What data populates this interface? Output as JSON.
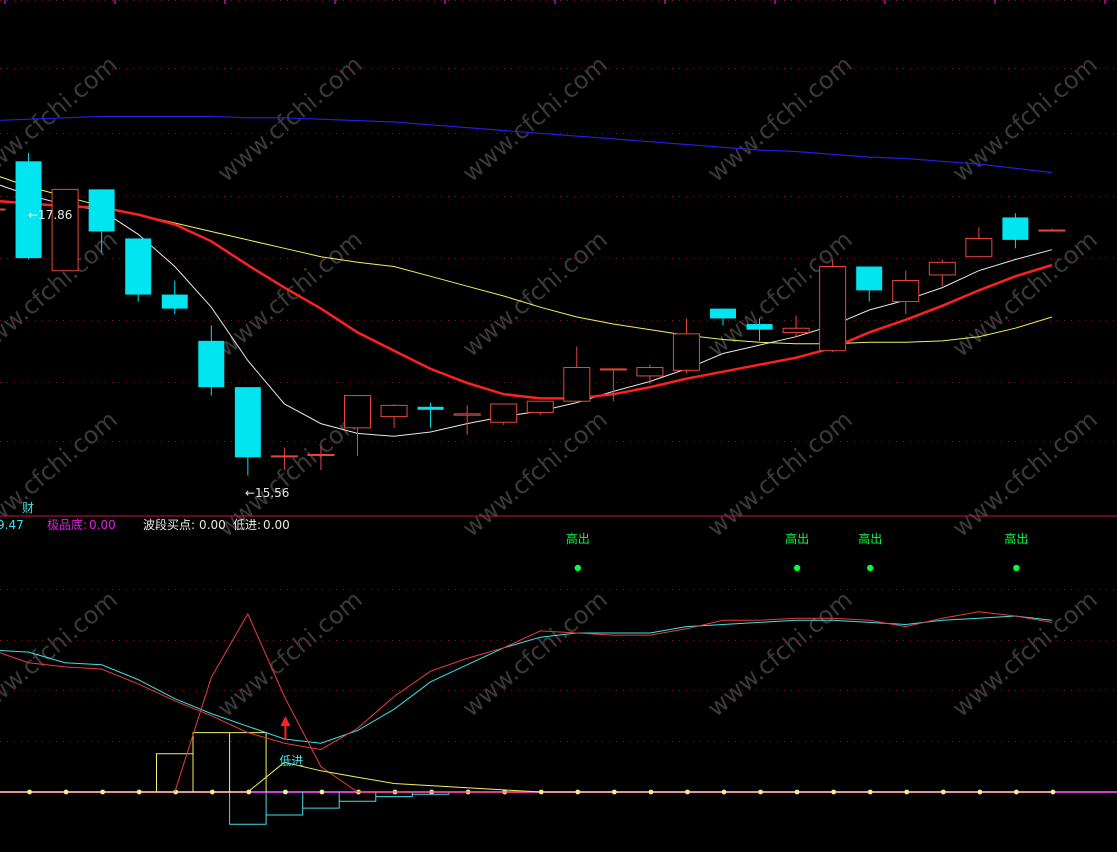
{
  "colors": {
    "background": "#000000",
    "grid": "#8a0e2c",
    "divider": "#d0103a",
    "up_candle": "#e8463c",
    "down_candle": "#00e5f0",
    "ma_fast": "#e8e8e8",
    "ma_mid": "#ff2020",
    "ma_slow": "#f0f060",
    "ma_long": "#2020e0",
    "osc_cyan": "#40e0e8",
    "osc_red": "#e83c3c",
    "osc_yellow": "#f0f060",
    "baseline": "#d040d0",
    "marker_green": "#00ff40"
  },
  "watermark": "www.cfchi.com",
  "price_panel": {
    "high_label": "←17.86",
    "low_label": "←15.56"
  },
  "indicator_bar": {
    "fragment_left": "9.47",
    "fragment_top": "财",
    "items": [
      {
        "label": "极品底:",
        "value": "0.00",
        "color": "#e020e0"
      },
      {
        "label": "波段买点:",
        "value": "0.00",
        "color": "#e8e8e8"
      },
      {
        "label": "低进:",
        "value": "0.00",
        "color": "#e8e8e8"
      }
    ]
  },
  "osc_panel": {
    "low_entry_label": "低进",
    "signal_label": "高出"
  },
  "chart_data": [
    {
      "type": "candlestick",
      "title": "",
      "high_marker": 17.86,
      "low_marker": 15.56,
      "ylim": [
        15.3,
        18.95
      ],
      "candles": [
        {
          "o": 17.46,
          "h": 17.46,
          "l": 17.46,
          "c": 17.46
        },
        {
          "o": 17.8,
          "h": 17.86,
          "l": 17.1,
          "c": 17.11
        },
        {
          "o": 17.02,
          "h": 17.6,
          "l": 17.02,
          "c": 17.6
        },
        {
          "o": 17.6,
          "h": 17.6,
          "l": 17.15,
          "c": 17.3
        },
        {
          "o": 17.25,
          "h": 17.25,
          "l": 16.8,
          "c": 16.85
        },
        {
          "o": 16.85,
          "h": 16.95,
          "l": 16.71,
          "c": 16.75
        },
        {
          "o": 16.52,
          "h": 16.63,
          "l": 16.13,
          "c": 16.19
        },
        {
          "o": 16.19,
          "h": 16.19,
          "l": 15.56,
          "c": 15.69
        },
        {
          "o": 15.7,
          "h": 15.76,
          "l": 15.6,
          "c": 15.7
        },
        {
          "o": 15.71,
          "h": 15.77,
          "l": 15.6,
          "c": 15.71
        },
        {
          "o": 15.9,
          "h": 16.13,
          "l": 15.7,
          "c": 16.13
        },
        {
          "o": 15.98,
          "h": 16.07,
          "l": 15.9,
          "c": 16.06
        },
        {
          "o": 16.05,
          "h": 16.08,
          "l": 15.9,
          "c": 16.04
        },
        {
          "o": 15.99,
          "h": 16.06,
          "l": 15.85,
          "c": 16.0
        },
        {
          "o": 15.94,
          "h": 16.07,
          "l": 15.92,
          "c": 16.07
        },
        {
          "o": 16.01,
          "h": 16.09,
          "l": 15.99,
          "c": 16.09
        },
        {
          "o": 16.09,
          "h": 16.48,
          "l": 16.09,
          "c": 16.33
        },
        {
          "o": 16.32,
          "h": 16.32,
          "l": 16.09,
          "c": 16.32
        },
        {
          "o": 16.27,
          "h": 16.35,
          "l": 16.21,
          "c": 16.33
        },
        {
          "o": 16.31,
          "h": 16.68,
          "l": 16.29,
          "c": 16.57
        },
        {
          "o": 16.75,
          "h": 16.75,
          "l": 16.63,
          "c": 16.68
        },
        {
          "o": 16.64,
          "h": 16.68,
          "l": 16.52,
          "c": 16.6
        },
        {
          "o": 16.58,
          "h": 16.7,
          "l": 16.55,
          "c": 16.61
        },
        {
          "o": 16.45,
          "h": 17.1,
          "l": 16.44,
          "c": 17.05
        },
        {
          "o": 17.05,
          "h": 17.05,
          "l": 16.8,
          "c": 16.88
        },
        {
          "o": 16.8,
          "h": 17.02,
          "l": 16.71,
          "c": 16.95
        },
        {
          "o": 16.99,
          "h": 17.1,
          "l": 16.91,
          "c": 17.08
        },
        {
          "o": 17.12,
          "h": 17.33,
          "l": 17.12,
          "c": 17.25
        },
        {
          "o": 17.4,
          "h": 17.43,
          "l": 17.18,
          "c": 17.24
        },
        {
          "o": 17.31,
          "h": 17.32,
          "l": 17.3,
          "c": 17.31
        }
      ],
      "ma_fast": [
        17.65,
        17.56,
        17.49,
        17.45,
        17.28,
        17.05,
        16.76,
        16.38,
        16.07,
        15.93,
        15.86,
        15.84,
        15.87,
        15.93,
        15.98,
        16.02,
        16.08,
        16.16,
        16.23,
        16.32,
        16.43,
        16.49,
        16.55,
        16.63,
        16.74,
        16.81,
        16.9,
        17.02,
        17.1,
        17.17
      ],
      "ma_mid": [
        17.52,
        17.5,
        17.48,
        17.47,
        17.42,
        17.35,
        17.23,
        17.06,
        16.9,
        16.75,
        16.58,
        16.45,
        16.32,
        16.22,
        16.14,
        16.11,
        16.11,
        16.14,
        16.19,
        16.25,
        16.3,
        16.35,
        16.4,
        16.47,
        16.58,
        16.67,
        16.77,
        16.88,
        16.98,
        17.06
      ],
      "ma_slow": [
        17.71,
        17.62,
        17.55,
        17.48,
        17.42,
        17.36,
        17.3,
        17.24,
        17.18,
        17.12,
        17.08,
        17.05,
        16.98,
        16.91,
        16.84,
        16.76,
        16.69,
        16.64,
        16.6,
        16.56,
        16.53,
        16.51,
        16.5,
        16.5,
        16.51,
        16.51,
        16.52,
        16.55,
        16.61,
        16.69
      ],
      "ma_long": [
        18.09,
        18.1,
        18.11,
        18.12,
        18.12,
        18.12,
        18.12,
        18.11,
        18.11,
        18.1,
        18.09,
        18.08,
        18.06,
        18.04,
        18.02,
        18.0,
        17.98,
        17.96,
        17.94,
        17.92,
        17.9,
        17.88,
        17.87,
        17.85,
        17.83,
        17.82,
        17.8,
        17.78,
        17.75,
        17.72
      ]
    },
    {
      "type": "line",
      "title": "",
      "ylim": [
        -5,
        100
      ],
      "series": [
        {
          "color_key": "osc_cyan",
          "values": [
            67,
            66,
            61,
            60,
            53,
            44,
            37,
            31,
            25,
            23,
            29,
            39,
            52,
            60,
            68,
            73,
            75,
            75,
            75,
            78,
            79,
            80,
            81,
            81,
            80,
            79,
            81,
            82,
            83,
            81
          ]
        },
        {
          "color_key": "osc_red",
          "values": [
            67,
            61,
            59,
            58,
            51,
            43,
            36,
            28,
            23,
            20,
            30,
            45,
            57,
            63,
            68,
            76,
            75,
            74,
            74,
            77,
            81,
            81,
            82,
            82,
            81,
            78,
            82,
            85,
            83,
            80
          ]
        },
        {
          "color_key": "osc_red",
          "values": [
            0,
            0,
            0,
            0,
            0,
            0,
            54,
            84,
            45,
            12,
            0,
            0,
            0,
            0,
            0,
            0,
            0,
            0,
            0,
            0,
            0,
            0,
            0,
            0,
            0,
            0,
            0,
            0,
            0,
            0
          ]
        },
        {
          "color_key": "osc_yellow",
          "values": [
            0,
            0,
            0,
            0,
            0,
            0,
            0,
            0,
            14,
            10,
            7,
            4,
            3,
            2,
            1,
            0,
            0,
            0,
            0,
            0,
            0,
            0,
            0,
            0,
            0,
            0,
            0,
            0,
            0,
            0
          ]
        }
      ],
      "step_yellow": [
        0,
        0,
        0,
        0,
        0,
        18,
        28,
        28,
        0,
        0,
        0,
        0,
        0,
        0,
        0,
        0,
        0,
        0,
        0,
        0,
        0,
        0,
        0,
        0,
        0,
        0,
        0,
        0,
        0,
        0
      ],
      "step_cyan": [
        0,
        0,
        0,
        0,
        0,
        0,
        0,
        -14,
        -10,
        -7,
        -4,
        -2,
        -1,
        0,
        0,
        0,
        0,
        0,
        0,
        0,
        0,
        0,
        0,
        0,
        0,
        0,
        0,
        0,
        0,
        0
      ],
      "signal_indices": [
        16,
        22,
        24,
        28
      ],
      "low_entry_index": 8
    }
  ]
}
